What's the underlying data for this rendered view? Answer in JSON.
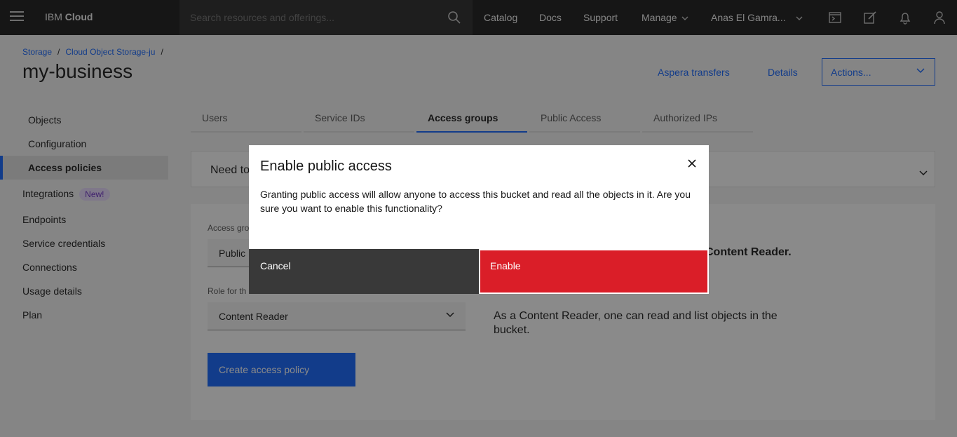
{
  "header": {
    "brand_prefix": "IBM",
    "brand_suffix": "Cloud",
    "search_placeholder": "Search resources and offerings...",
    "nav": [
      "Catalog",
      "Docs",
      "Support",
      "Manage"
    ],
    "account": "Anas El Gamra..."
  },
  "breadcrumb": [
    "Storage",
    "Cloud Object Storage-ju"
  ],
  "page_title": "my-business",
  "top_links": {
    "aspera": "Aspera transfers",
    "details": "Details",
    "actions": "Actions..."
  },
  "sidebar": {
    "sub_items": [
      "Objects",
      "Configuration",
      "Access policies"
    ],
    "items": [
      "Integrations",
      "Endpoints",
      "Service credentials",
      "Connections",
      "Usage details",
      "Plan"
    ],
    "new_tag": "New!"
  },
  "tabs": [
    "Users",
    "Service IDs",
    "Access groups",
    "Public Access",
    "Authorized IPs"
  ],
  "background": {
    "need_text": "Need to",
    "access_group_label": "Access gro",
    "access_group_value": "Public",
    "role_label": "Role for th",
    "role_value": "Content Reader",
    "role_suffix": "Content Reader.",
    "description": "As a Content Reader, one can read and list objects in the bucket.",
    "create_button": "Create access policy"
  },
  "modal": {
    "title": "Enable public access",
    "body": "Granting public access will allow anyone to access this bucket and read all the objects in it. Are you sure you want to enable this functionality?",
    "cancel": "Cancel",
    "enable": "Enable"
  },
  "colors": {
    "primary": "#0f62fe",
    "danger": "#da1e28",
    "header_bg": "#161616"
  }
}
